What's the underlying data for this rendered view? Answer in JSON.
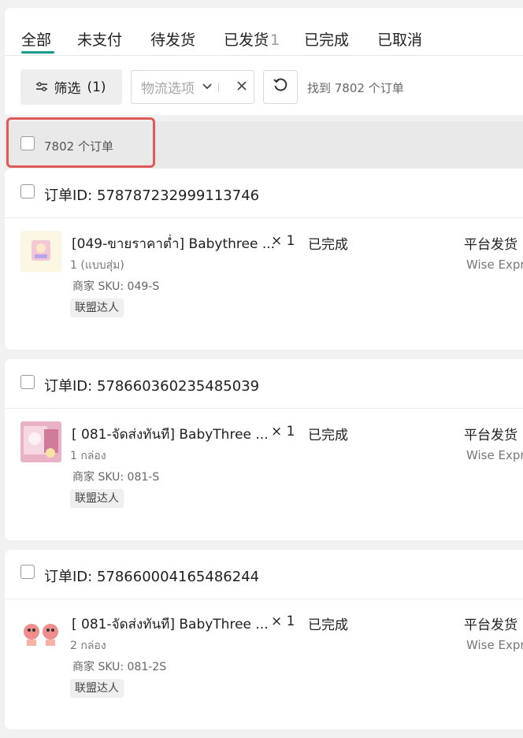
{
  "tabs": [
    {
      "label": "全部",
      "count": ""
    },
    {
      "label": "未支付",
      "count": ""
    },
    {
      "label": "待发货",
      "count": ""
    },
    {
      "label": "已发货",
      "count": "1"
    },
    {
      "label": "已完成",
      "count": ""
    },
    {
      "label": "已取消",
      "count": ""
    }
  ],
  "toolbar": {
    "filter_label": "筛选",
    "filter_count": "(1)",
    "logistics_placeholder": "物流选项",
    "result_text": "找到 7802 个订单"
  },
  "select_all": {
    "label": "7802 个订单"
  },
  "orders": [
    {
      "id_label": "订单ID: 578787232999113746",
      "product_title": "[049-ขายราคาต่ำ] Babythree ...",
      "variant": "1 (แบบสุ่ม)",
      "sku": "商家 SKU: 049-S",
      "tag": "联盟达人",
      "quantity": "× 1",
      "status": "已完成",
      "shipping_method": "平台发货",
      "carrier": "Wise Expre"
    },
    {
      "id_label": "订单ID: 578660360235485039",
      "product_title": "[ 081-จัดส่งทันที] BabyThree ...",
      "variant": "1 กล่อง",
      "sku": "商家 SKU: 081-S",
      "tag": "联盟达人",
      "quantity": "× 1",
      "status": "已完成",
      "shipping_method": "平台发货",
      "carrier": "Wise Expre"
    },
    {
      "id_label": "订单ID: 578660004165486244",
      "product_title": "[ 081-จัดส่งทันที] BabyThree ...",
      "variant": "2 กล่อง",
      "sku": "商家 SKU: 081-2S",
      "tag": "联盟达人",
      "quantity": "× 1",
      "status": "已完成",
      "shipping_method": "平台发货",
      "carrier": "Wise Expre"
    }
  ],
  "colors": {
    "accent": "#169a8c",
    "highlight": "#e05a57"
  },
  "icons": {
    "filter": "sliders-icon",
    "chevron": "chevron-down-icon",
    "clear": "close-icon",
    "reset": "refresh-icon"
  }
}
